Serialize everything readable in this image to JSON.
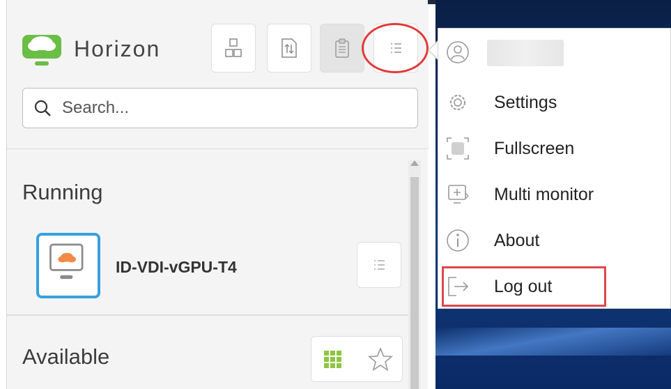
{
  "app": {
    "title": "Horizon",
    "brand_color": "#6abd45"
  },
  "toolbar": {
    "buttons": [
      {
        "icon": "windows-icon",
        "disabled": false
      },
      {
        "icon": "file-transfer-icon",
        "disabled": false
      },
      {
        "icon": "clipboard-icon",
        "disabled": true
      },
      {
        "icon": "list-menu-icon",
        "disabled": false,
        "highlighted": true
      }
    ]
  },
  "search": {
    "placeholder": "Search..."
  },
  "sections": {
    "running": {
      "title": "Running",
      "items": [
        {
          "name": "ID-VDI-vGPU-T4",
          "icon": "desktop-cloud-icon",
          "accent": "#37a0de"
        }
      ]
    },
    "available": {
      "title": "Available",
      "controls": [
        {
          "icon": "grid-view-icon",
          "color": "#8cc63f"
        },
        {
          "icon": "star-icon"
        }
      ]
    }
  },
  "user_menu": {
    "user_icon": "user-avatar-icon",
    "items": [
      {
        "label": "Settings",
        "icon": "gear-icon"
      },
      {
        "label": "Fullscreen",
        "icon": "fullscreen-icon"
      },
      {
        "label": "Multi monitor",
        "icon": "multi-monitor-icon"
      },
      {
        "label": "About",
        "icon": "info-icon"
      },
      {
        "label": "Log out",
        "icon": "logout-icon",
        "highlighted": true
      }
    ],
    "highlight_color": "#e0474a"
  }
}
